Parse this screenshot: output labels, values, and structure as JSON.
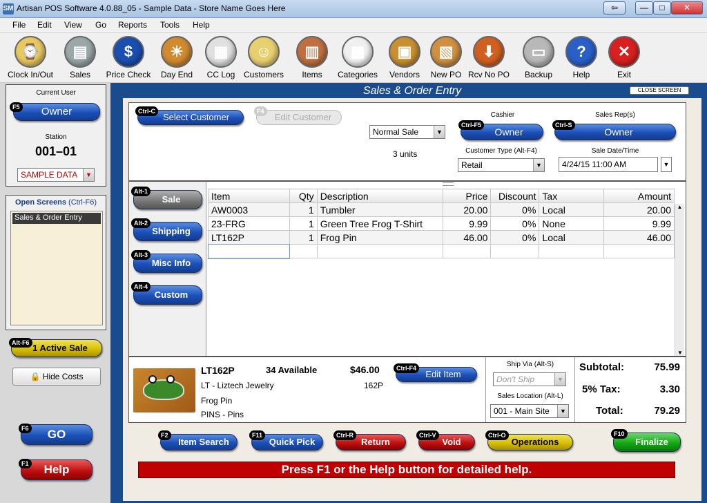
{
  "window": {
    "title": "Artisan POS Software 4.0.88_05 - Sample Data - Store Name Goes Here",
    "app_icon": "SM",
    "back_btn": "⇦",
    "min_btn": "—",
    "max_btn": "□",
    "close_btn": "✕"
  },
  "menu": [
    "File",
    "Edit",
    "View",
    "Go",
    "Reports",
    "Tools",
    "Help"
  ],
  "toolbar": [
    {
      "label": "Clock In/Out",
      "icon": "clock-in-out-icon",
      "color": "#e8c860",
      "glyph": "⌚"
    },
    {
      "label": "Sales",
      "icon": "cash-register-icon",
      "color": "#9aa8a8",
      "glyph": "▤"
    },
    {
      "label": "Price Check",
      "icon": "dollar-icon",
      "color": "#1a4fb0",
      "glyph": "$"
    },
    {
      "label": "Day End",
      "icon": "sunset-icon",
      "color": "#d08a30",
      "glyph": "☀"
    },
    {
      "label": "CC Log",
      "icon": "cc-log-icon",
      "color": "#e0e0e0",
      "glyph": "▦"
    },
    {
      "label": "Customers",
      "icon": "customer-icon",
      "color": "#e8d070",
      "glyph": "☺"
    },
    {
      "label": "Items",
      "icon": "items-icon",
      "color": "#c07040",
      "glyph": "▥"
    },
    {
      "label": "Categories",
      "icon": "categories-icon",
      "color": "#f0f0f0",
      "glyph": "▩"
    },
    {
      "label": "Vendors",
      "icon": "vendor-icon",
      "color": "#c89030",
      "glyph": "▣"
    },
    {
      "label": "New PO",
      "icon": "new-po-icon",
      "color": "#d09040",
      "glyph": "▧"
    },
    {
      "label": "Rcv No PO",
      "icon": "receive-icon",
      "color": "#d06020",
      "glyph": "⬇"
    },
    {
      "label": "Backup",
      "icon": "backup-icon",
      "color": "#b8b8b8",
      "glyph": "▭"
    },
    {
      "label": "Help",
      "icon": "help-icon",
      "color": "#2a5fc8",
      "glyph": "?"
    },
    {
      "label": "Exit",
      "icon": "exit-icon",
      "color": "#d82020",
      "glyph": "✕"
    }
  ],
  "left": {
    "current_user_label": "Current User",
    "user_key": "F5",
    "user": "Owner",
    "station_label": "Station",
    "station": "001–01",
    "data_select": "SAMPLE DATA",
    "open_screens_title": "Open Screens",
    "open_screens_shortcut": "(Ctrl-F6)",
    "open_screens": [
      "Sales & Order Entry"
    ],
    "active_sale_key": "Alt-F6",
    "active_sale": "1 Active Sale",
    "hide_costs": "Hide Costs",
    "go_key": "F6",
    "go": "GO",
    "help_key": "F1",
    "help": "Help"
  },
  "header": {
    "title": "Sales & Order Entry",
    "close_screen": "CLOSE SCREEN"
  },
  "top": {
    "select_customer_key": "Ctrl-C",
    "select_customer": "Select Customer",
    "edit_customer_key": "F4",
    "edit_customer": "Edit Customer",
    "sale_type": "Normal Sale",
    "units": "3 units",
    "cashier_label": "Cashier",
    "cashier_key": "Ctrl-F5",
    "cashier": "Owner",
    "sales_rep_label": "Sales Rep(s)",
    "sales_rep_key": "Ctrl-S",
    "sales_rep": "Owner",
    "customer_type_label": "Customer Type (Alt-F4)",
    "customer_type": "Retail",
    "sale_date_label": "Sale Date/Time",
    "sale_date": "4/24/15 11:00 AM"
  },
  "side_tabs": [
    {
      "key": "Alt-1",
      "label": "Sale"
    },
    {
      "key": "Alt-2",
      "label": "Shipping"
    },
    {
      "key": "Alt-3",
      "label": "Misc Info"
    },
    {
      "key": "Alt-4",
      "label": "Custom"
    }
  ],
  "grid": {
    "columns": [
      "Item",
      "Qty",
      "Description",
      "Price",
      "Discount",
      "Tax",
      "Amount"
    ],
    "rows": [
      [
        "AW0003",
        "1",
        "Tumbler",
        "20.00",
        "0%",
        "Local",
        "20.00"
      ],
      [
        "23-FRG",
        "1",
        "Green Tree Frog T-Shirt",
        "9.99",
        "0%",
        "None",
        "9.99"
      ],
      [
        "LT162P",
        "1",
        "Frog Pin",
        "46.00",
        "0%",
        "Local",
        "46.00"
      ]
    ]
  },
  "item_detail": {
    "sku": "LT162P",
    "available": "34 Available",
    "price": "$46.00",
    "vendor": "LT - Liztech Jewelry",
    "code": "162P",
    "description": "Frog Pin",
    "category": "PINS - Pins",
    "edit_key": "Ctrl-F4",
    "edit": "Edit Item"
  },
  "shipping": {
    "ship_via_label": "Ship Via (Alt-S)",
    "ship_via": "Don't Ship",
    "location_label": "Sales Location (Alt-L)",
    "location": "001 - Main Site"
  },
  "totals": {
    "subtotal_label": "Subtotal:",
    "subtotal": "75.99",
    "tax_label": "5% Tax:",
    "tax": "3.30",
    "total_label": "Total:",
    "total": "79.29"
  },
  "bottom": [
    {
      "key": "F2",
      "label": "Item Search",
      "style": "blue"
    },
    {
      "key": "F11",
      "label": "Quick Pick",
      "style": "blue"
    },
    {
      "key": "Ctrl-R",
      "label": "Return",
      "style": "red"
    },
    {
      "key": "Ctrl-V",
      "label": "Void",
      "style": "red"
    },
    {
      "key": "Ctrl-O",
      "label": "Operations",
      "style": "yellow"
    },
    {
      "key": "F10",
      "label": "Finalize",
      "style": "green"
    }
  ],
  "help_bar": "Press F1 or the Help button for detailed help."
}
